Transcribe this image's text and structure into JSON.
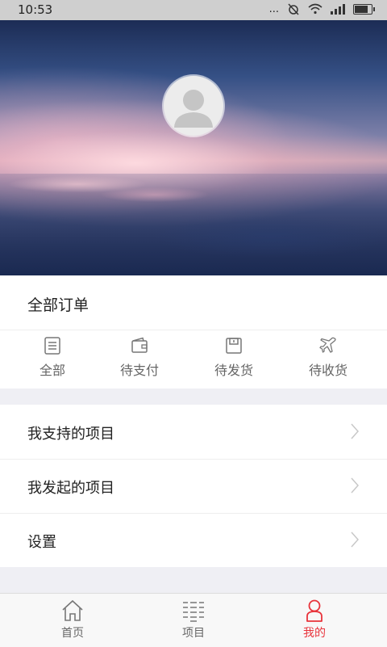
{
  "status_bar": {
    "time": "10:53",
    "signal_text": "..."
  },
  "orders": {
    "title": "全部订单",
    "items": [
      {
        "label": "全部",
        "icon": "list-icon"
      },
      {
        "label": "待支付",
        "icon": "wallet-icon"
      },
      {
        "label": "待发货",
        "icon": "package-icon"
      },
      {
        "label": "待收货",
        "icon": "plane-icon"
      }
    ]
  },
  "menu": {
    "items": [
      {
        "label": "我支持的项目"
      },
      {
        "label": "我发起的项目"
      },
      {
        "label": "设置"
      }
    ]
  },
  "tabbar": {
    "tabs": [
      {
        "label": "首页",
        "icon": "home-icon",
        "active": false
      },
      {
        "label": "项目",
        "icon": "project-list-icon",
        "active": false
      },
      {
        "label": "我的",
        "icon": "person-icon",
        "active": true
      }
    ],
    "active_color": "#e8333b"
  }
}
